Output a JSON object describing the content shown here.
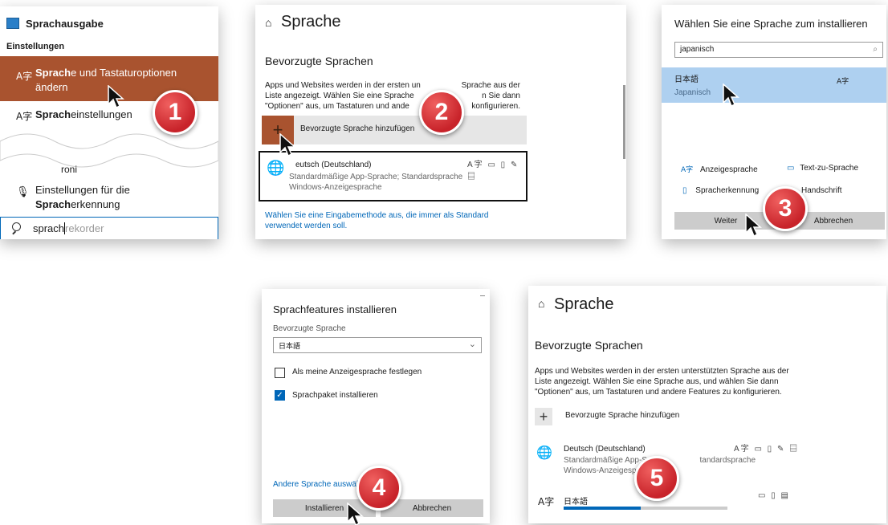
{
  "panel1": {
    "top_item": "Sprachausgabe",
    "section": "Einstellungen",
    "item1_bold": "Sprach",
    "item1_rest": "e und Tastaturoptionen ändern",
    "item2_bold": "Sprach",
    "item2_rest": "einstellungen",
    "fragment": "roni",
    "item3_line1": "Einstellungen für die",
    "item3_bold": "Sprach",
    "item3_rest": "erkennung",
    "search_typed": "sprach",
    "search_suggest": "rekorder",
    "badge": "1"
  },
  "panel2": {
    "title": "Sprache",
    "heading": "Bevorzugte Sprachen",
    "desc_line1a": "Apps und Websites werden in der ersten un",
    "desc_line1b": "Sprache aus der",
    "desc_line2a": "Liste angezeigt. Wählen Sie eine Sprache",
    "desc_line2b": "n Sie dann",
    "desc_line3a": "\"Optionen\" aus, um Tastaturen und ande",
    "desc_line3b": "konfigurieren.",
    "add_label": "Bevorzugte Sprache hinzufügen",
    "lang_name": "eutsch (Deutschland)",
    "lang_sub1": "Standardmäßige App-Sprache; Standardsprache",
    "lang_sub2": "Windows-Anzeigesprache",
    "link": "Wählen Sie eine Eingabemethode aus, die immer als Standard verwendet werden soll.",
    "badge": "2"
  },
  "panel3": {
    "title": "Wählen Sie eine Sprache zum installieren",
    "search_value": "japanisch",
    "result_native": "日本語",
    "result_name": "Japanisch",
    "feature1": "Anzeigesprache",
    "feature2": "Text-zu-Sprache",
    "feature3": "Spracherkennung",
    "feature4": "Handschrift",
    "next": "Weiter",
    "cancel": "Abbrechen",
    "badge": "3"
  },
  "panel4": {
    "title": "Sprachfeatures installieren",
    "pref_label": "Bevorzugte Sprache",
    "select_value": "日本語",
    "check1": "Als meine Anzeigesprache festlegen",
    "check1_checked": false,
    "check2": "Sprachpaket installieren",
    "check2_checked": true,
    "other_link": "Andere Sprache auswähl",
    "install": "Installieren",
    "cancel": "Abbrechen",
    "badge": "4"
  },
  "panel5": {
    "title": "Sprache",
    "heading": "Bevorzugte Sprachen",
    "desc_line1": "Apps und Websites werden in der ersten unterstützten Sprache aus der",
    "desc_line2": "Liste angezeigt. Wählen Sie eine Sprache aus, und wählen Sie dann",
    "desc_line3": "\"Optionen\" aus, um Tastaturen und andere Features zu konfigurieren.",
    "add_label": "Bevorzugte Sprache hinzufügen",
    "lang1_name": "Deutsch (Deutschland)",
    "lang1_sub1a": "Standardmäßige App-Sp",
    "lang1_sub1b": "tandardsprache",
    "lang1_sub2": "Windows-Anzeigespra",
    "lang2_name": "日本語",
    "download_progress": 0.47,
    "badge": "5"
  },
  "colors": {
    "highlight": "#a9532f",
    "accent": "#0067b8",
    "selection": "#aed0f0",
    "badge": "#d3262d"
  }
}
